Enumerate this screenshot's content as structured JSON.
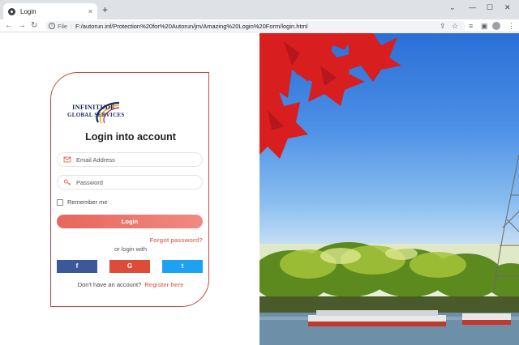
{
  "browser": {
    "tab_title": "Login",
    "tab_close": "×",
    "new_tab": "+",
    "url_scheme_label": "File",
    "url": "F:/autorun.inf/Protection%20for%20Autorun/jm/Amazing%20Login%20Form/login.html",
    "icons": [
      "back-icon",
      "forward-icon",
      "reload-icon",
      "info-icon",
      "share-icon",
      "star-icon",
      "reading-list-icon",
      "sidebar-icon",
      "profile-avatar",
      "kebab-menu-icon",
      "minimize-icon",
      "maximize-icon",
      "close-icon",
      "chevron-down-icon"
    ]
  },
  "logo": {
    "line1": "INFINITUDE",
    "line2": "GLOBAL SERVICES"
  },
  "form": {
    "title": "Login into account",
    "email_placeholder": "Email Address",
    "password_placeholder": "Password",
    "remember_label": "Remember me",
    "login_button": "Login",
    "forgot_link": "Forgot password?",
    "or_login_with": "or login with",
    "social": {
      "facebook": "f",
      "google": "G",
      "twitter": "t"
    },
    "signup_text": "Don't have an account?",
    "register_link": "Register here"
  },
  "colors": {
    "accent": "#e6665d",
    "card_border": "#c9463d",
    "facebook": "#3b5998",
    "google": "#dd4b39",
    "twitter": "#1da1f2"
  }
}
